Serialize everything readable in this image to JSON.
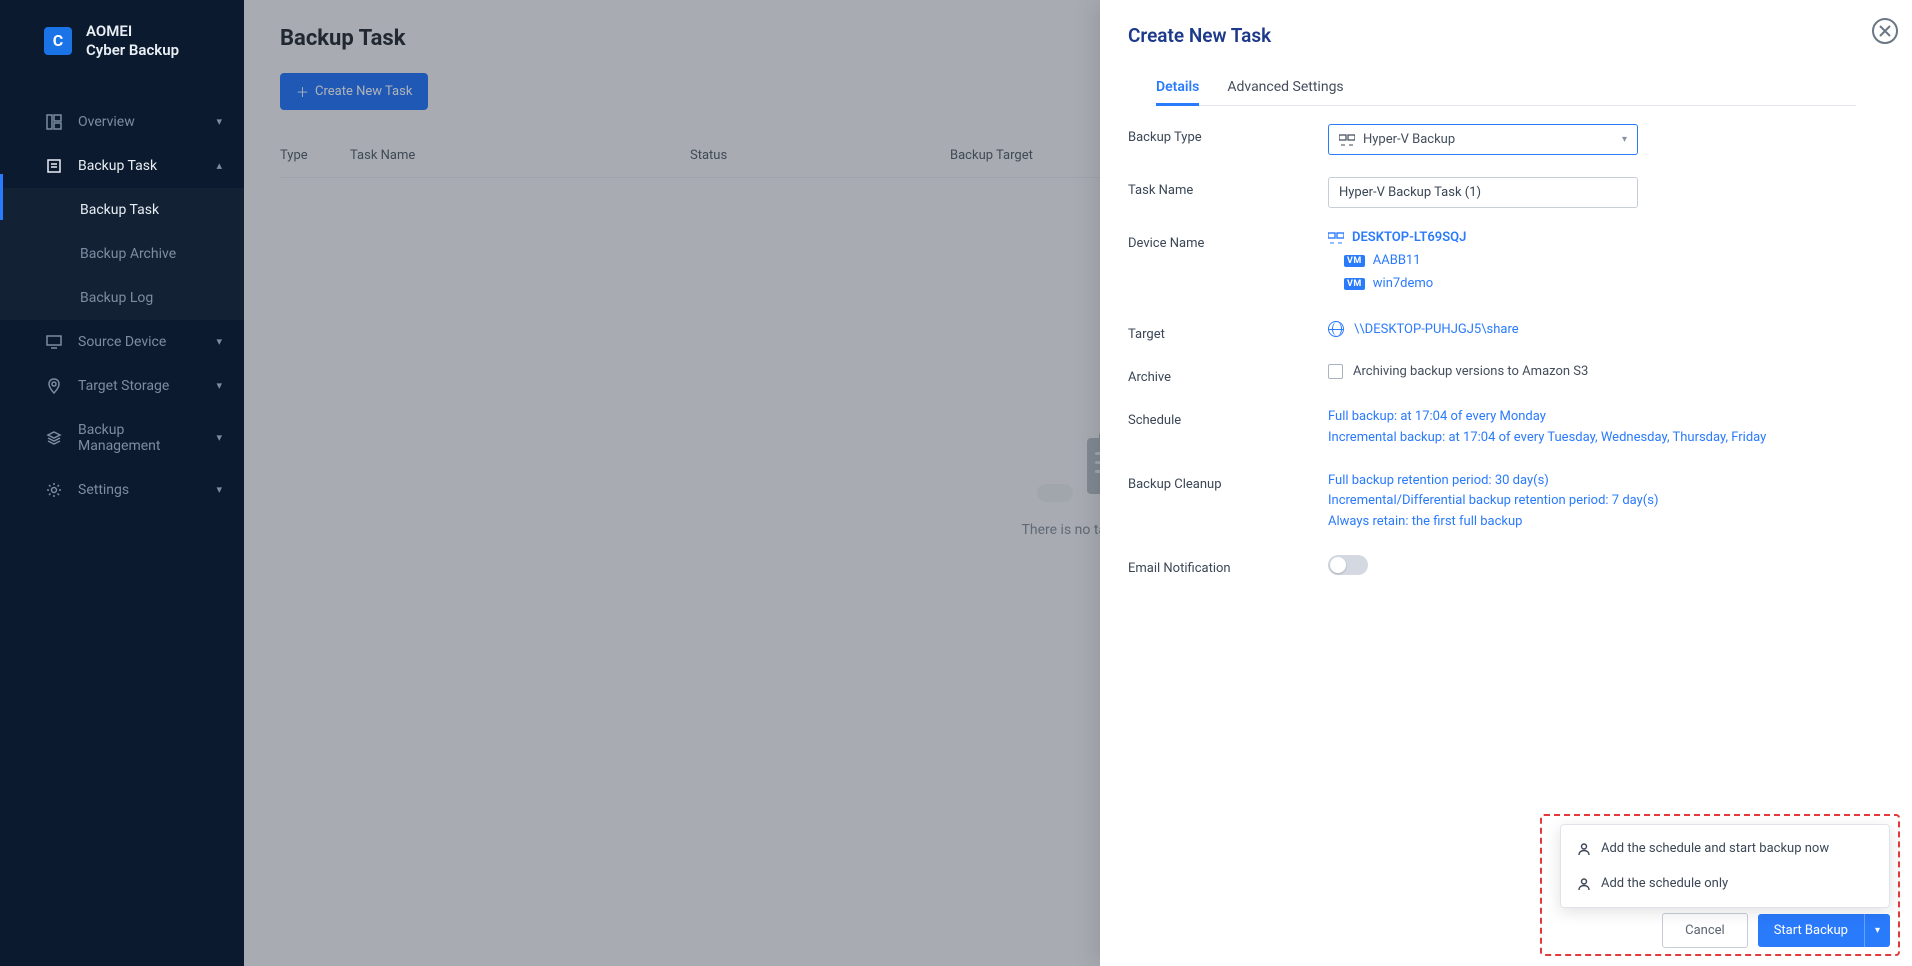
{
  "app": {
    "name": "AOMEI\nCyber Backup"
  },
  "sidebar": {
    "overview": "Overview",
    "backup_task": "Backup Task",
    "subs": {
      "task": "Backup Task",
      "archive": "Backup Archive",
      "log": "Backup Log"
    },
    "source": "Source Device",
    "target": "Target Storage",
    "mgmt": "Backup Management",
    "settings": "Settings"
  },
  "page": {
    "title": "Backup Task",
    "create_btn": "Create New Task",
    "cols": {
      "type": "Type",
      "name": "Task Name",
      "status": "Status",
      "target": "Backup Target"
    },
    "empty": "There is no task, p"
  },
  "panel": {
    "title": "Create New Task",
    "tabs": {
      "details": "Details",
      "advanced": "Advanced Settings"
    },
    "labels": {
      "backup_type": "Backup Type",
      "task_name": "Task Name",
      "device_name": "Device Name",
      "target": "Target",
      "archive": "Archive",
      "schedule": "Schedule",
      "cleanup": "Backup Cleanup",
      "email": "Email Notification"
    },
    "backup_type_value": "Hyper-V Backup",
    "task_name_value": "Hyper-V Backup Task (1)",
    "device": {
      "host": "DESKTOP-LT69SQJ",
      "vms": [
        "AABB11",
        "win7demo"
      ]
    },
    "target_value": "\\\\DESKTOP-PUHJGJ5\\share",
    "archive_text": "Archiving backup versions to Amazon S3",
    "schedule_lines": [
      "Full backup: at 17:04 of every Monday",
      "Incremental backup: at 17:04 of every Tuesday, Wednesday, Thursday, Friday"
    ],
    "cleanup_lines": [
      "Full backup retention period: 30 day(s)",
      "Incremental/Differential backup retention period: 7 day(s)",
      "Always retain: the first full backup"
    ],
    "footer": {
      "cancel": "Cancel",
      "start": "Start Backup"
    },
    "popup": [
      "Add the schedule and start backup now",
      "Add the schedule only"
    ]
  }
}
